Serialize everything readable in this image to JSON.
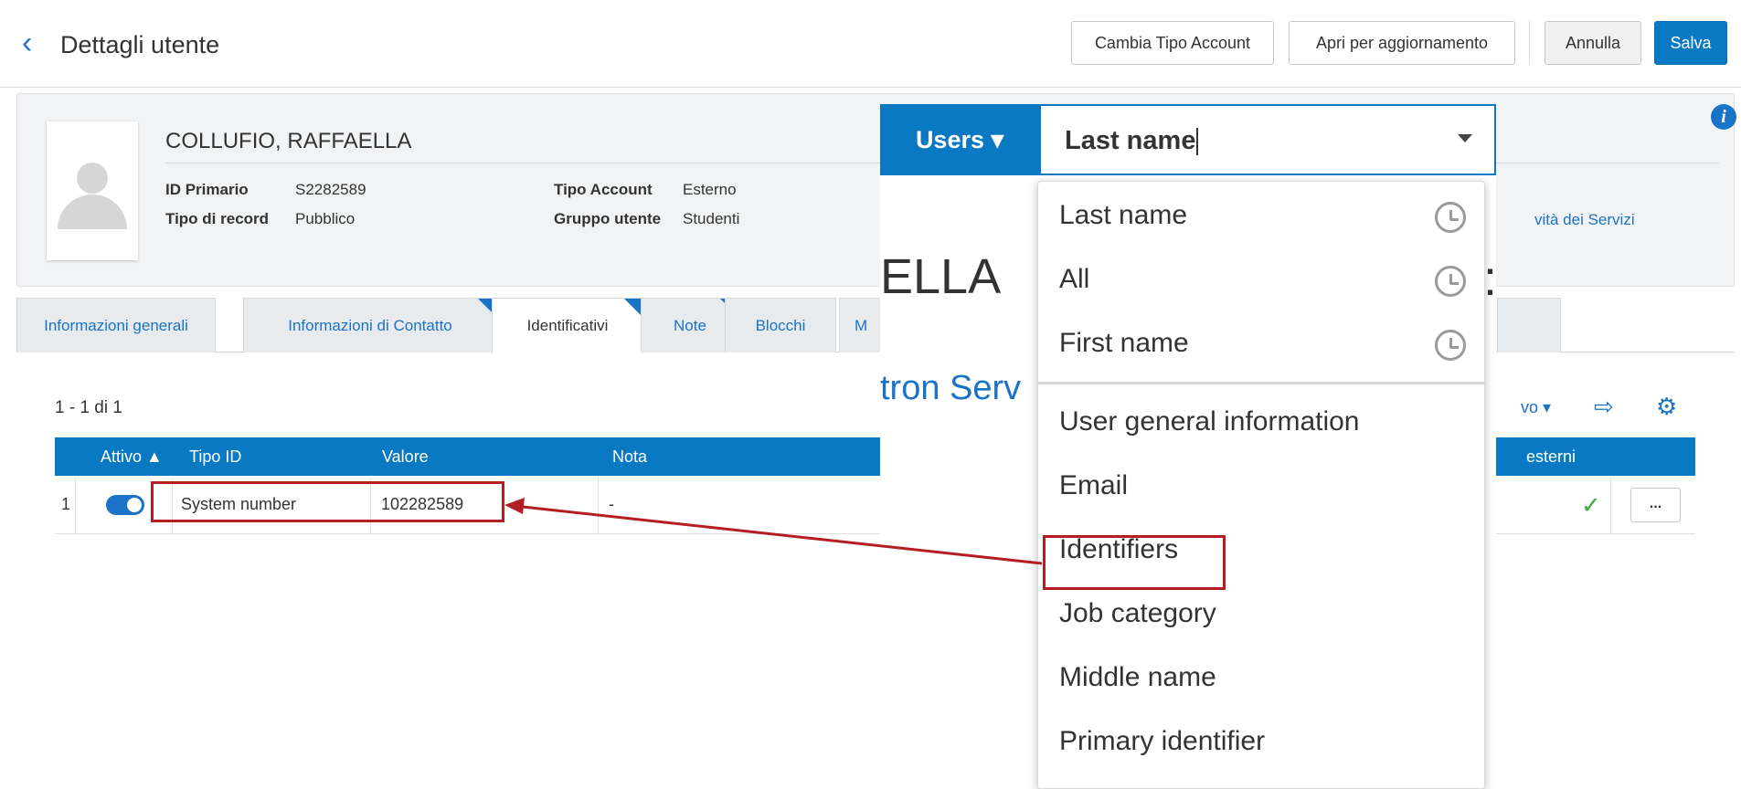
{
  "header": {
    "title": "Dettagli utente",
    "buttons": {
      "change_account_type": "Cambia Tipo Account",
      "open_for_update": "Apri per aggiornamento",
      "cancel": "Annulla",
      "save": "Salva"
    }
  },
  "user": {
    "name": "COLLUFIO, RAFFAELLA",
    "primary_id_label": "ID Primario",
    "primary_id_value": "S2282589",
    "record_type_label": "Tipo di record",
    "record_type_value": "Pubblico",
    "account_type_label": "Tipo Account",
    "account_type_value": "Esterno",
    "user_group_label": "Gruppo utente",
    "user_group_value": "Studenti",
    "services_link": "vità dei Servizi"
  },
  "tabs": [
    {
      "label": "Informazioni generali",
      "active": false
    },
    {
      "label": "Informazioni di Contatto",
      "active": false
    },
    {
      "label": "Identificativi",
      "active": true
    },
    {
      "label": "Note",
      "active": false
    },
    {
      "label": "Blocchi",
      "active": false
    },
    {
      "label": "M",
      "active": false
    }
  ],
  "table": {
    "count_text": "1 - 1 di 1",
    "toolbar_text": "vo ▾",
    "headers": {
      "active": "Attivo ▲",
      "id_type": "Tipo ID",
      "value": "Valore",
      "note": "Nota",
      "external": "esterni"
    },
    "rows": [
      {
        "num": "1",
        "active": true,
        "id_type": "System number",
        "value": "102282589",
        "note": "-",
        "more": "..."
      }
    ]
  },
  "search": {
    "scope_label": "Users ▾",
    "field_value": "Last name",
    "bg_text_1": "ELLA",
    "bg_text_2": "tron Serv",
    "bg_text_3": ":",
    "options": [
      {
        "label": "Last name",
        "recent": true
      },
      {
        "label": "All",
        "recent": true
      },
      {
        "label": "First name",
        "recent": true
      },
      {
        "label": "User general information",
        "recent": false
      },
      {
        "label": "Email",
        "recent": false
      },
      {
        "label": "Identifiers",
        "recent": false,
        "highlighted": true
      },
      {
        "label": "Job category",
        "recent": false
      },
      {
        "label": "Middle name",
        "recent": false
      },
      {
        "label": "Primary identifier",
        "recent": false
      }
    ]
  },
  "colors": {
    "accent": "#0a79c4",
    "link": "#1a73c6",
    "highlight": "#b41e23",
    "check": "#3eaa3e"
  }
}
